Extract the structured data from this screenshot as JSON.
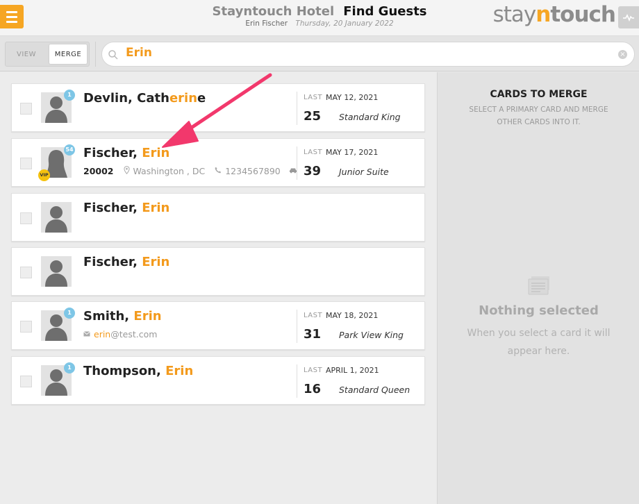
{
  "header": {
    "hotel_name": "Stayntouch Hotel",
    "page_title": "Find Guests",
    "user": "Erin Fischer",
    "date": "Thursday, 20 January 2022",
    "logo_pre": "stay",
    "logo_n": "n",
    "logo_post": "touch"
  },
  "toolbar": {
    "view_label": "VIEW",
    "merge_label": "MERGE",
    "search_value": "Erin",
    "clear_glyph": "×"
  },
  "results": [
    {
      "last_name": "Devlin, ",
      "first_pre": "Cath",
      "first_hl": "erin",
      "first_post": "e",
      "badge": "1",
      "last_label": "LAST",
      "last_date": "MAY 12, 2021",
      "nights": "25",
      "room": "Standard King"
    },
    {
      "last_name": "Fischer, ",
      "first_hl": "Erin",
      "badge": "54",
      "vip": "VIP",
      "zip": "20002",
      "city": "Washington , DC",
      "phone": "1234567890",
      "last_label": "LAST",
      "last_date": "MAY 17, 2021",
      "nights": "39",
      "room": "Junior Suite"
    },
    {
      "last_name": "Fischer, ",
      "first_hl": "Erin"
    },
    {
      "last_name": "Fischer, ",
      "first_hl": "Erin"
    },
    {
      "last_name": "Smith, ",
      "first_hl": "Erin",
      "badge": "1",
      "email_hl": "erin",
      "email_rest": "@test.com",
      "last_label": "LAST",
      "last_date": "MAY 18, 2021",
      "nights": "31",
      "room": "Park View King"
    },
    {
      "last_name": "Thompson, ",
      "first_hl": "Erin",
      "badge": "1",
      "last_label": "LAST",
      "last_date": "APRIL 1, 2021",
      "nights": "16",
      "room": "Standard Queen"
    }
  ],
  "merge_panel": {
    "title": "CARDS TO MERGE",
    "subtitle": "SELECT A PRIMARY CARD AND MERGE OTHER CARDS INTO IT.",
    "empty_title": "Nothing selected",
    "empty_hint": "When you select a card it will appear here."
  },
  "colors": {
    "accent": "#f39a1c",
    "badge": "#7ec6e6",
    "vip": "#f5c20f",
    "annotation_arrow": "#f2386c"
  },
  "icons": [
    "menu-icon",
    "activity-icon",
    "search-icon",
    "clear-icon",
    "guest-avatar-icon",
    "location-icon",
    "phone-icon",
    "car-icon",
    "mail-icon",
    "cards-icon"
  ]
}
